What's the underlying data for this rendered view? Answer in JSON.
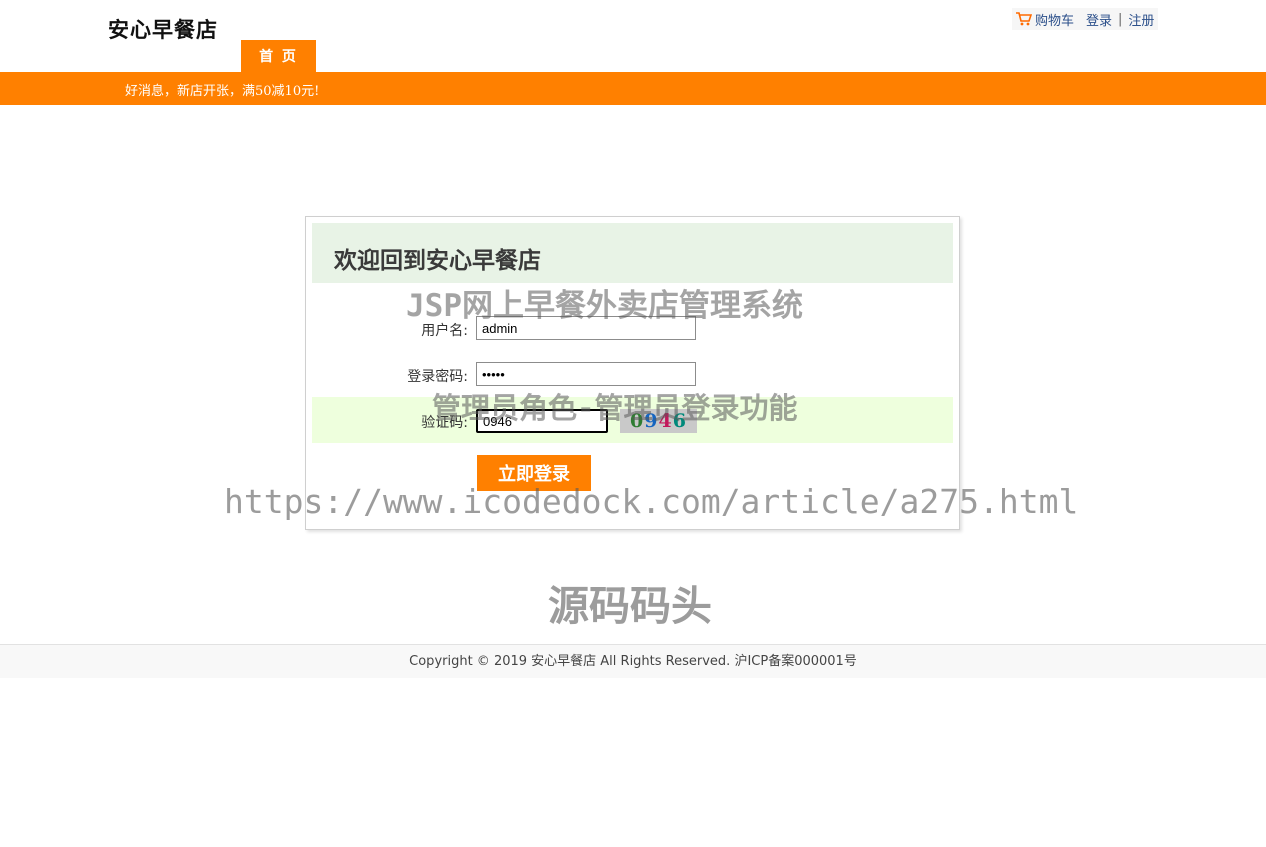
{
  "header": {
    "site_title": "安心早餐店",
    "nav_home": "首 页",
    "top_links": {
      "cart": "购物车",
      "login": "登录",
      "separator": "|",
      "register": "注册"
    }
  },
  "banner": {
    "notice": "好消息，新店开张，满50减10元!"
  },
  "login": {
    "heading": "欢迎回到安心早餐店",
    "username_label": "用户名:",
    "username_value": "admin",
    "password_label": "登录密码:",
    "password_value": "admin",
    "captcha_label": "验证码:",
    "captcha_value": "0946",
    "captcha_image_text": [
      "0",
      "9",
      "4",
      "6"
    ],
    "submit_label": "立即登录"
  },
  "watermarks": {
    "line1": "JSP网上早餐外卖店管理系统",
    "line2": "管理员角色-管理员登录功能",
    "url": "https://www.icodedock.com/article/a275.html",
    "brand": "源码码头"
  },
  "footer": {
    "copyright": "Copyright © 2019 安心早餐店 All Rights Reserved. 沪ICP备案000001号"
  },
  "colors": {
    "accent": "#ff8000",
    "login_head_bg": "#e8f3e6",
    "captcha_row_bg": "#eeffdd",
    "link": "#2b4f8a"
  },
  "icons": {
    "cart": "shopping-cart-icon"
  }
}
